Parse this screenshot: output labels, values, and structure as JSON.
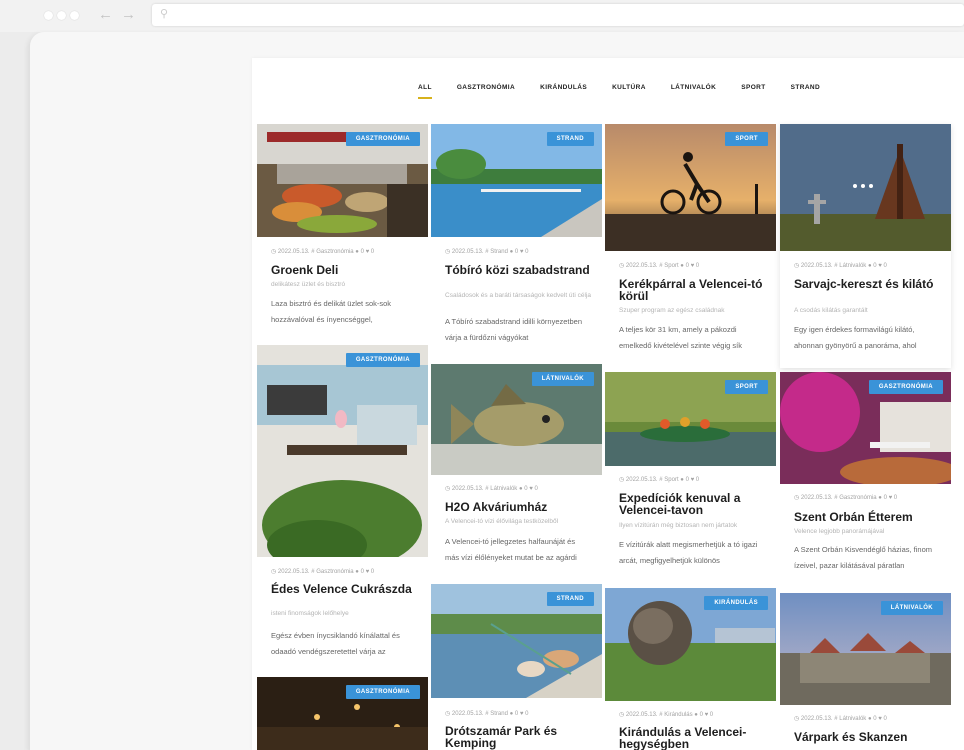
{
  "filters": [
    "ALL",
    "GASZTRONÓMIA",
    "KIRÁNDULÁS",
    "KULTÚRA",
    "LÁTNIVALÓK",
    "SPORT",
    "STRAND"
  ],
  "cards": [
    {
      "badge": "GASZTRONÓMIA",
      "meta": "◷ 2022.05.13. # Gasztronómia   ● 0   ♥ 0",
      "title": "Groenk Deli",
      "sub": "delikátesz üzlet és bisztró",
      "desc": "Laza bisztró és delikát üzlet sok-sok hozzávalóval és ínyencséggel,"
    },
    {
      "badge": "STRAND",
      "meta": "◷ 2022.05.13. # Strand   ● 0   ♥ 0",
      "title": "Tóbíró közi szabadstrand",
      "sub": "Családosok és a baráti társaságok kedvelt úti célja",
      "desc": "A Tóbíró szabadstrand idilli környezetben várja a fürdőzni vágyókat"
    },
    {
      "badge": "SPORT",
      "meta": "◷ 2022.05.13. # Sport   ● 0   ♥ 0",
      "title": "Kerékpárral a Velencei-tó körül",
      "sub": "Szuper program az egész családnak",
      "desc": "A teljes kör 31 km, amely a pákozdi emelkedő kivételével szinte végig sík"
    },
    {
      "badge": "",
      "meta": "◷ 2022.05.13. # Látnivalók   ● 0   ♥ 0",
      "title": "Sarvajc-kereszt és kilátó",
      "sub": "A csodás kilátás garantált",
      "desc": "Egy igen érdekes formavilágú kilátó, ahonnan gyönyörű a panoráma, ahol"
    },
    {
      "badge": "GASZTRONÓMIA",
      "meta": "◷ 2022.05.13. # Gasztronómia   ● 0   ♥ 0",
      "title": "Édes Velence Cukrászda",
      "sub": "isteni finomságok lelőhelye",
      "desc": "Egész évben ínycsiklandó kínálattal és odaadó vendégszeretettel várja az"
    },
    {
      "badge": "LÁTNIVALÓK",
      "meta": "◷ 2022.05.13. # Látnivalók   ● 0   ♥ 0",
      "title": "H2O Akváriumház",
      "sub": "A Velencei-tó vízi élővilága testközelből",
      "desc": "A Velencei-tó jellegzetes halfaunáját és más vízi élőlényeket mutat be az agárdi"
    },
    {
      "badge": "SPORT",
      "meta": "◷ 2022.05.13. # Sport   ● 0   ♥ 0",
      "title": "Expedíciók kenuval a Velencei-tavon",
      "sub": "Ilyen vízitúrán még biztosan nem jártatok",
      "desc": "E vízitúrák alatt megismerhetjük a tó igazi arcát, megfigyelhetjük különös"
    },
    {
      "badge": "GASZTRONÓMIA",
      "meta": "◷ 2022.05.13. # Gasztronómia   ● 0   ♥ 0",
      "title": "Szent Orbán Étterem",
      "sub": "Velence legjobb panorámájával",
      "desc": "A Szent Orbán Kisvendéglő házias, finom ízeivel, pazar kilátásával páratlan"
    },
    {
      "badge": "GASZTRONÓMIA",
      "meta": "",
      "title": "",
      "sub": "",
      "desc": ""
    },
    {
      "badge": "STRAND",
      "meta": "◷ 2022.05.13. # Strand   ● 0   ♥ 0",
      "title": "Drótszamár Park és Kemping",
      "sub": "",
      "desc": ""
    },
    {
      "badge": "KIRÁNDULÁS",
      "meta": "◷ 2022.05.13. # Kirándulás   ● 0   ♥ 0",
      "title": "Kirándulás a Velencei-hegységben",
      "sub": "",
      "desc": ""
    },
    {
      "badge": "LÁTNIVALÓK",
      "meta": "◷ 2022.05.13. # Látnivalók   ● 0   ♥ 0",
      "title": "Várpark és Skanzen",
      "sub": "",
      "desc": ""
    }
  ],
  "colors": {
    "accent": "#d7b21c",
    "badge": "#3a93d8"
  }
}
